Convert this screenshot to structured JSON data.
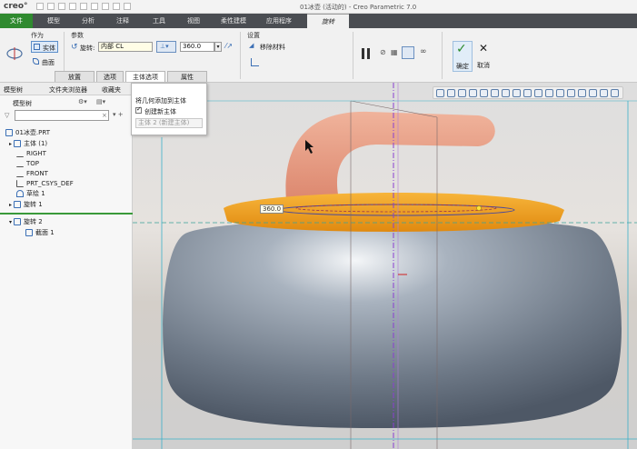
{
  "titlebar": {
    "logo": "creo°",
    "window_title": "01冰壶 (活动的) - Creo Parametric 7.0"
  },
  "menu": {
    "tabs": [
      "文件",
      "模型",
      "分析",
      "注释",
      "工具",
      "视图",
      "柔性建模",
      "应用程序"
    ],
    "active_tab": "旋转"
  },
  "ribbon": {
    "as_label": "作为",
    "solid_label": "实体",
    "surface_label": "曲面",
    "params_label": "参数",
    "rotate_label": "旋转:",
    "rotate_mode": "内部 CL",
    "angle_value": "360.0",
    "settings_label": "设置",
    "remove_material_label": "移除材料",
    "ok_label": "确定",
    "cancel_label": "取消",
    "subtabs": [
      "放置",
      "选项",
      "主体选项",
      "属性"
    ]
  },
  "popup": {
    "title": "将几何添加到主体",
    "create_new_body_label": "创建新主体",
    "body_field_value": "主体 2 (新建主体)"
  },
  "leftpanel": {
    "tabs": [
      "模型树",
      "文件夹浏览器",
      "收藏夹"
    ],
    "tree_header": "模型树",
    "items": [
      "01冰壶.PRT",
      "主体 (1)",
      "RIGHT",
      "TOP",
      "FRONT",
      "PRT_CSYS_DEF",
      "草绘 1",
      "旋转 1",
      "旋转 2",
      "截面 1"
    ]
  },
  "viewport": {
    "dimension_value": "360.0"
  },
  "colors": {
    "accent_green": "#2f8a2f",
    "menubar": "#4a4d52",
    "stone_orange": "#f2a01e",
    "stone_gray": "#7e8896",
    "handle_salmon": "#e8957a"
  }
}
